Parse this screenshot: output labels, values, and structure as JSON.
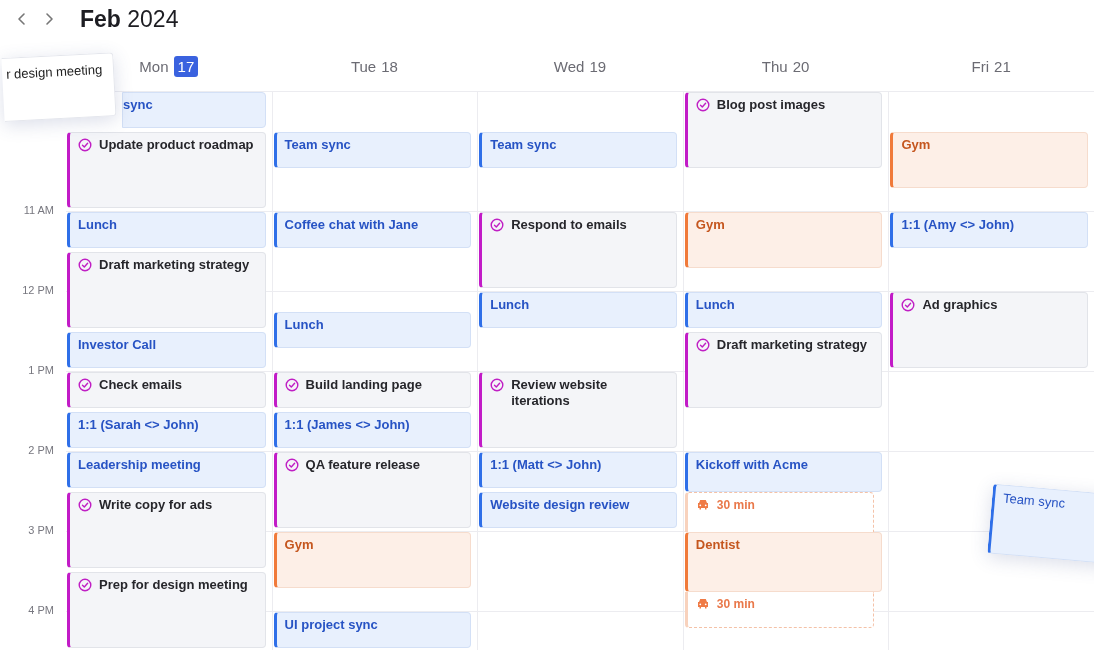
{
  "header": {
    "title": "**Feb** 2024"
  },
  "days": [
    {
      "weekday": "Mon",
      "date": "17",
      "today": true,
      "events": [
        {
          "kind": "meeting",
          "title": "sync",
          "covered": true
        },
        {
          "kind": "task",
          "title": "Update product roadmap",
          "long": true
        },
        {
          "kind": "meeting",
          "title": "Lunch"
        },
        {
          "kind": "task",
          "title": "Draft marketing strategy",
          "long": true
        },
        {
          "kind": "meeting",
          "title": "Investor Call"
        },
        {
          "kind": "task",
          "title": "Check emails"
        },
        {
          "kind": "meeting",
          "title": "1:1 (Sarah <> John)"
        },
        {
          "kind": "meeting",
          "title": "Leadership meeting"
        },
        {
          "kind": "task",
          "title": "Write copy for ads",
          "long": true
        },
        {
          "kind": "task",
          "title": "Prep for design meeting",
          "long": true
        }
      ]
    },
    {
      "weekday": "Tue",
      "date": "18",
      "today": false,
      "events": [
        {
          "kind": "meeting",
          "title": "Team sync",
          "break_before": true
        },
        {
          "kind": "meeting",
          "title": "Coffee chat with Jane",
          "break_before": true
        },
        {
          "kind": "meeting",
          "title": "Lunch",
          "break_before": true,
          "short_break_before": true
        },
        {
          "kind": "task",
          "title": "Build landing page",
          "short_break_before": true
        },
        {
          "kind": "meeting",
          "title": "1:1 (James <> John)"
        },
        {
          "kind": "task",
          "title": "QA feature release",
          "long": true
        },
        {
          "kind": "personal",
          "title": "Gym",
          "medium": true
        },
        {
          "kind": "meeting",
          "title": "UI project sync",
          "short_break_before": true
        }
      ]
    },
    {
      "weekday": "Wed",
      "date": "19",
      "today": false,
      "events": [
        {
          "kind": "meeting",
          "title": "Team sync",
          "break_before": true
        },
        {
          "kind": "task",
          "title": "Respond to emails",
          "break_before": true,
          "long": true
        },
        {
          "kind": "meeting",
          "title": "Lunch"
        },
        {
          "kind": "task",
          "title": "Review website iterations",
          "break_before": true,
          "long": true
        },
        {
          "kind": "meeting",
          "title": "1:1 (Matt <> John)"
        },
        {
          "kind": "meeting",
          "title": "Website design review"
        }
      ]
    },
    {
      "weekday": "Thu",
      "date": "20",
      "today": false,
      "events": [
        {
          "kind": "task",
          "title": "Blog post images",
          "long": true
        },
        {
          "kind": "personal",
          "title": "Gym",
          "break_before": true,
          "medium": true
        },
        {
          "kind": "meeting",
          "title": "Lunch",
          "short_break_before": true
        },
        {
          "kind": "task",
          "title": "Draft marketing strategy",
          "long": true
        },
        {
          "kind": "meeting",
          "title": "Kickoff with Acme",
          "break_before": true
        },
        {
          "kind": "travel",
          "title": "30 min"
        },
        {
          "kind": "personal",
          "title": "Dentist",
          "medium": true
        },
        {
          "kind": "travel",
          "title": "30 min"
        }
      ]
    },
    {
      "weekday": "Fri",
      "date": "21",
      "today": false,
      "events": [
        {
          "kind": "personal",
          "title": "Gym",
          "break_before": true,
          "medium": true
        },
        {
          "kind": "meeting",
          "title": "1:1 (Amy <> John)",
          "short_break_before": true
        },
        {
          "kind": "task",
          "title": "Ad graphics",
          "break_before": true,
          "long": true
        }
      ]
    }
  ],
  "hour_labels": [
    "11 AM",
    "12 PM",
    "1 PM",
    "2 PM",
    "3 PM",
    "4 PM"
  ],
  "dragged_cards": [
    {
      "kind": "task",
      "title": "r design meeting"
    },
    {
      "kind": "meeting",
      "title": "Team sync"
    }
  ]
}
